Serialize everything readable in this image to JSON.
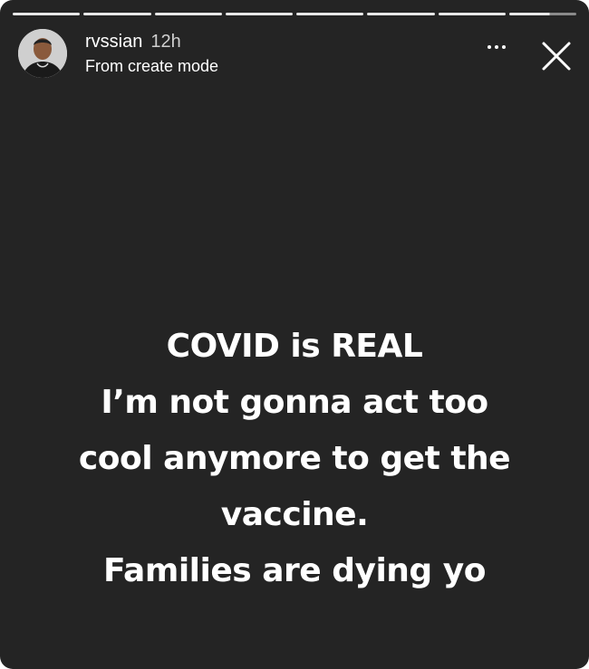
{
  "progress": {
    "segments": [
      1,
      1,
      1,
      1,
      1,
      1,
      1,
      0.6
    ]
  },
  "header": {
    "username": "rvssian",
    "time": "12h",
    "subtitle": "From create mode",
    "more_icon": "more-horizontal-icon",
    "close_icon": "close-icon"
  },
  "story": {
    "lines": [
      "COVID is REAL",
      "I’m not gonna act too",
      "cool anymore to get the",
      "vaccine.",
      "Families are dying yo"
    ]
  },
  "colors": {
    "background": "#242424",
    "text": "#ffffff",
    "progress_done": "#e8e8e8",
    "progress_pending": "#8a8a8a"
  }
}
